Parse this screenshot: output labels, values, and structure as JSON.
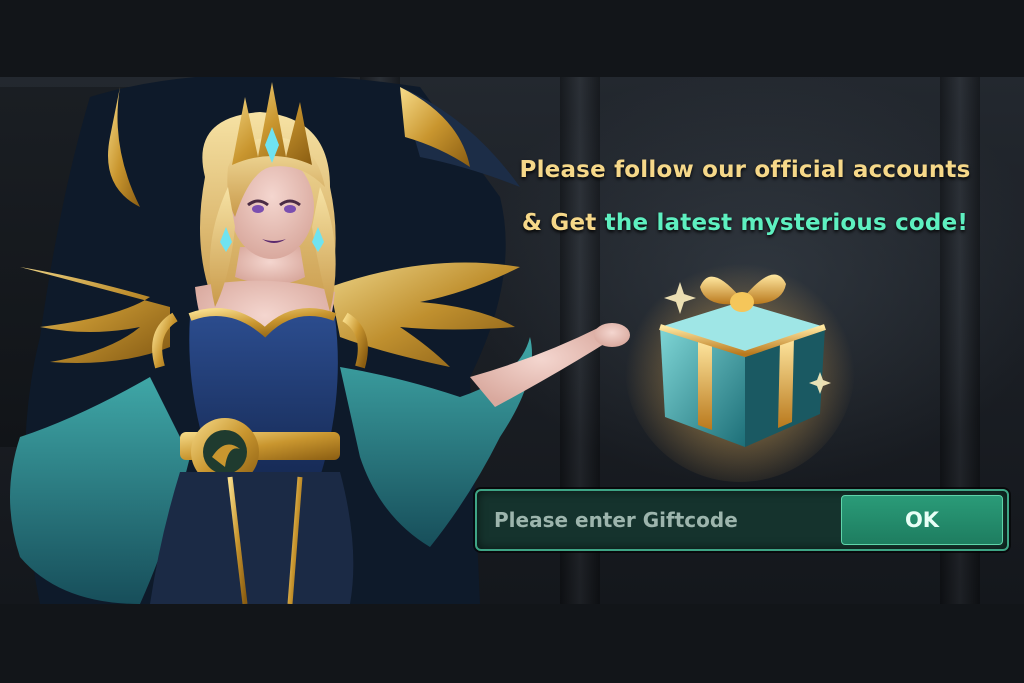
{
  "promo": {
    "line1": "Please follow our official accounts",
    "line2_prefix": "& Get ",
    "line2_accent": "the latest mysterious code!"
  },
  "giftcode": {
    "placeholder": "Please enter Giftcode",
    "value": "",
    "ok_label": "OK"
  },
  "colors": {
    "gold_text": "#f6d889",
    "accent_text": "#5ef0c0",
    "button_green": "#2a9b78",
    "input_bg": "#15332d",
    "letterbox": "#121519"
  },
  "icons": {
    "gift": "gift-box-icon",
    "character": "sorceress-character-art"
  }
}
